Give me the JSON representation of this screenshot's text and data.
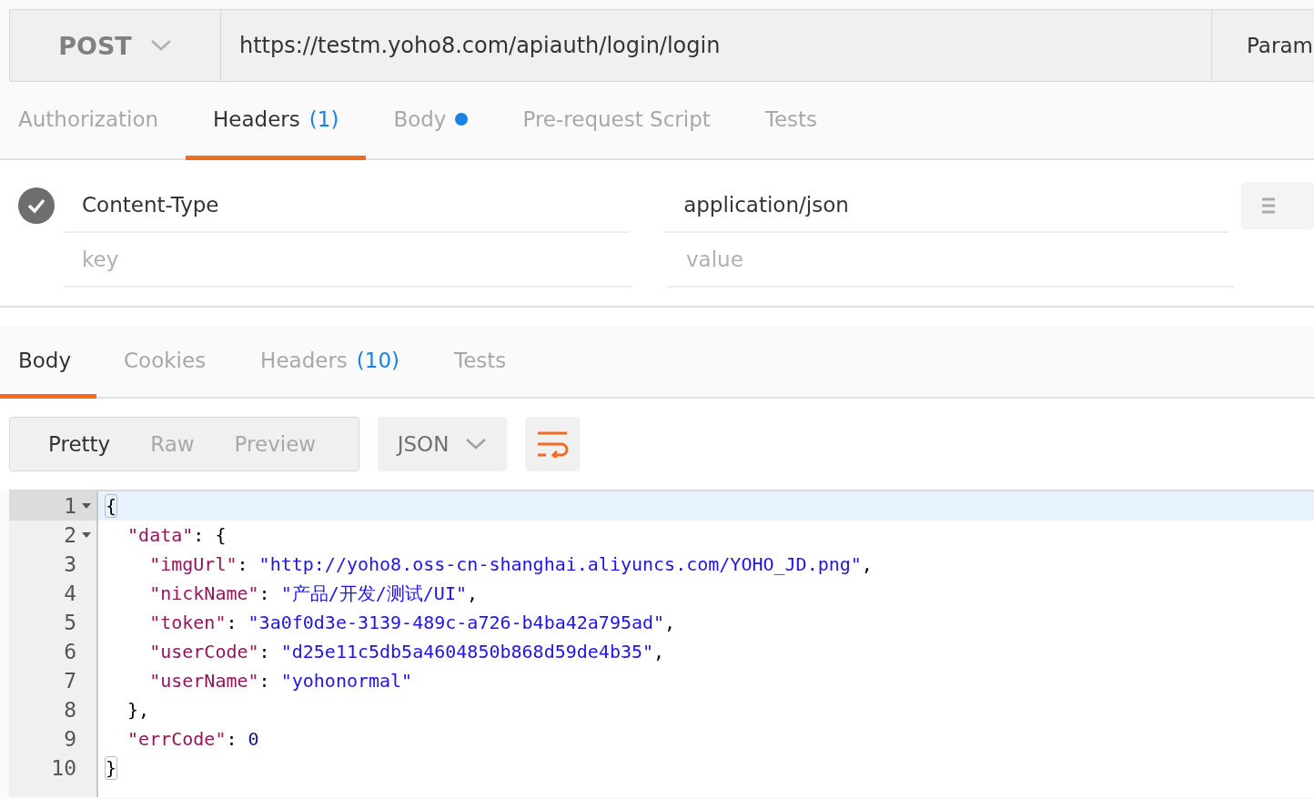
{
  "request_bar": {
    "method": "POST",
    "url": "https://testm.yoho8.com/apiauth/login/login",
    "params_button": "Param"
  },
  "request_tabs": [
    {
      "label": "Authorization",
      "selected": false
    },
    {
      "label": "Headers",
      "count": "(1)",
      "selected": true
    },
    {
      "label": "Body",
      "has_content": true,
      "selected": false
    },
    {
      "label": "Pre-request Script",
      "selected": false
    },
    {
      "label": "Tests",
      "selected": false
    }
  ],
  "header_rows": [
    {
      "enabled": true,
      "key": "Content-Type",
      "value": "application/json"
    },
    {
      "key_placeholder": "key",
      "value_placeholder": "value"
    }
  ],
  "response_tabs": [
    {
      "label": "Body",
      "selected": true
    },
    {
      "label": "Cookies",
      "selected": false
    },
    {
      "label": "Headers",
      "count": "(10)",
      "selected": false
    },
    {
      "label": "Tests",
      "selected": false
    }
  ],
  "view_modes": [
    {
      "label": "Pretty",
      "selected": true
    },
    {
      "label": "Raw",
      "selected": false
    },
    {
      "label": "Preview",
      "selected": false
    }
  ],
  "format_dropdown": "JSON",
  "editor": {
    "lines": [
      {
        "number": "1",
        "foldable": true,
        "active": true,
        "tokens": [
          {
            "kind": "bracket-match",
            "text": "{"
          }
        ]
      },
      {
        "number": "2",
        "foldable": true,
        "active": false,
        "tokens": [
          {
            "kind": "key",
            "text": "  \"data\""
          },
          {
            "kind": "punct",
            "text": ": {"
          }
        ]
      },
      {
        "number": "3",
        "foldable": false,
        "active": false,
        "tokens": [
          {
            "kind": "key",
            "text": "    \"imgUrl\""
          },
          {
            "kind": "punct",
            "text": ": "
          },
          {
            "kind": "string",
            "text": "\"http://yoho8.oss-cn-shanghai.aliyuncs.com/YOHO_JD.png\""
          },
          {
            "kind": "punct",
            "text": ","
          }
        ]
      },
      {
        "number": "4",
        "foldable": false,
        "active": false,
        "tokens": [
          {
            "kind": "key",
            "text": "    \"nickName\""
          },
          {
            "kind": "punct",
            "text": ": "
          },
          {
            "kind": "string",
            "text": "\"产品/开发/测试/UI\""
          },
          {
            "kind": "punct",
            "text": ","
          }
        ]
      },
      {
        "number": "5",
        "foldable": false,
        "active": false,
        "tokens": [
          {
            "kind": "key",
            "text": "    \"token\""
          },
          {
            "kind": "punct",
            "text": ": "
          },
          {
            "kind": "string",
            "text": "\"3a0f0d3e-3139-489c-a726-b4ba42a795ad\""
          },
          {
            "kind": "punct",
            "text": ","
          }
        ]
      },
      {
        "number": "6",
        "foldable": false,
        "active": false,
        "tokens": [
          {
            "kind": "key",
            "text": "    \"userCode\""
          },
          {
            "kind": "punct",
            "text": ": "
          },
          {
            "kind": "string",
            "text": "\"d25e11c5db5a4604850b868d59de4b35\""
          },
          {
            "kind": "punct",
            "text": ","
          }
        ]
      },
      {
        "number": "7",
        "foldable": false,
        "active": false,
        "tokens": [
          {
            "kind": "key",
            "text": "    \"userName\""
          },
          {
            "kind": "punct",
            "text": ": "
          },
          {
            "kind": "string",
            "text": "\"yohonormal\""
          }
        ]
      },
      {
        "number": "8",
        "foldable": false,
        "active": false,
        "tokens": [
          {
            "kind": "punct",
            "text": "  },"
          }
        ]
      },
      {
        "number": "9",
        "foldable": false,
        "active": false,
        "tokens": [
          {
            "kind": "key",
            "text": "  \"errCode\""
          },
          {
            "kind": "punct",
            "text": ": "
          },
          {
            "kind": "number",
            "text": "0"
          }
        ]
      },
      {
        "number": "10",
        "foldable": false,
        "active": false,
        "tokens": [
          {
            "kind": "bracket-match",
            "text": "}"
          }
        ]
      }
    ]
  }
}
